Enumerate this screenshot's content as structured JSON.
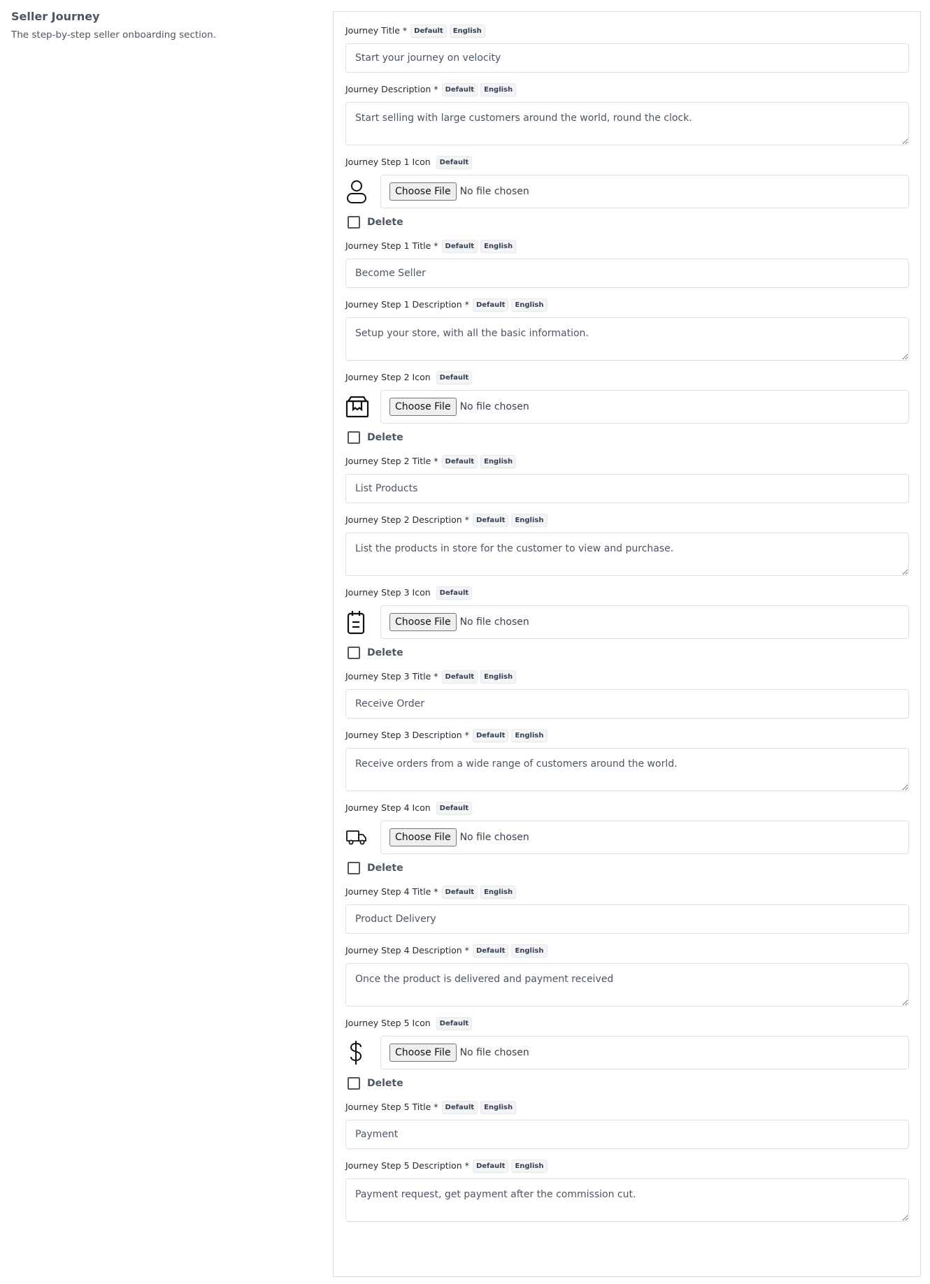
{
  "section": {
    "title": "Seller Journey",
    "description": "The step-by-step seller onboarding section."
  },
  "badges": {
    "default": "Default",
    "english": "English"
  },
  "journey_title": {
    "label": "Journey Title *",
    "value": "Start your journey on velocity"
  },
  "journey_description": {
    "label": "Journey Description *",
    "value": "Start selling with large customers around the world, round the clock."
  },
  "file_input": {
    "button": "Choose File",
    "status": "No file chosen"
  },
  "delete_label": "Delete",
  "steps": [
    {
      "icon_label": "Journey Step 1 Icon",
      "icon": "user-icon",
      "title_label": "Journey Step 1 Title *",
      "title": "Become Seller",
      "desc_label": "Journey Step 1 Description *",
      "description": "Setup your store, with all the basic information."
    },
    {
      "icon_label": "Journey Step 2 Icon",
      "icon": "store-box-icon",
      "title_label": "Journey Step 2 Title *",
      "title": "List Products",
      "desc_label": "Journey Step 2 Description *",
      "description": "List the products in store for the customer to view and purchase."
    },
    {
      "icon_label": "Journey Step 3 Icon",
      "icon": "clipboard-icon",
      "title_label": "Journey Step 3 Title *",
      "title": "Receive Order",
      "desc_label": "Journey Step 3 Description *",
      "description": "Receive orders from a wide range of customers around the world."
    },
    {
      "icon_label": "Journey Step 4 Icon",
      "icon": "delivery-truck-icon",
      "title_label": "Journey Step 4 Title *",
      "title": "Product Delivery",
      "desc_label": "Journey Step 4 Description *",
      "description": "Once the product is delivered and payment received"
    },
    {
      "icon_label": "Journey Step 5 Icon",
      "icon": "dollar-icon",
      "title_label": "Journey Step 5 Title *",
      "title": "Payment",
      "desc_label": "Journey Step 5 Description *",
      "description": "Payment request, get payment after the commission cut."
    }
  ]
}
